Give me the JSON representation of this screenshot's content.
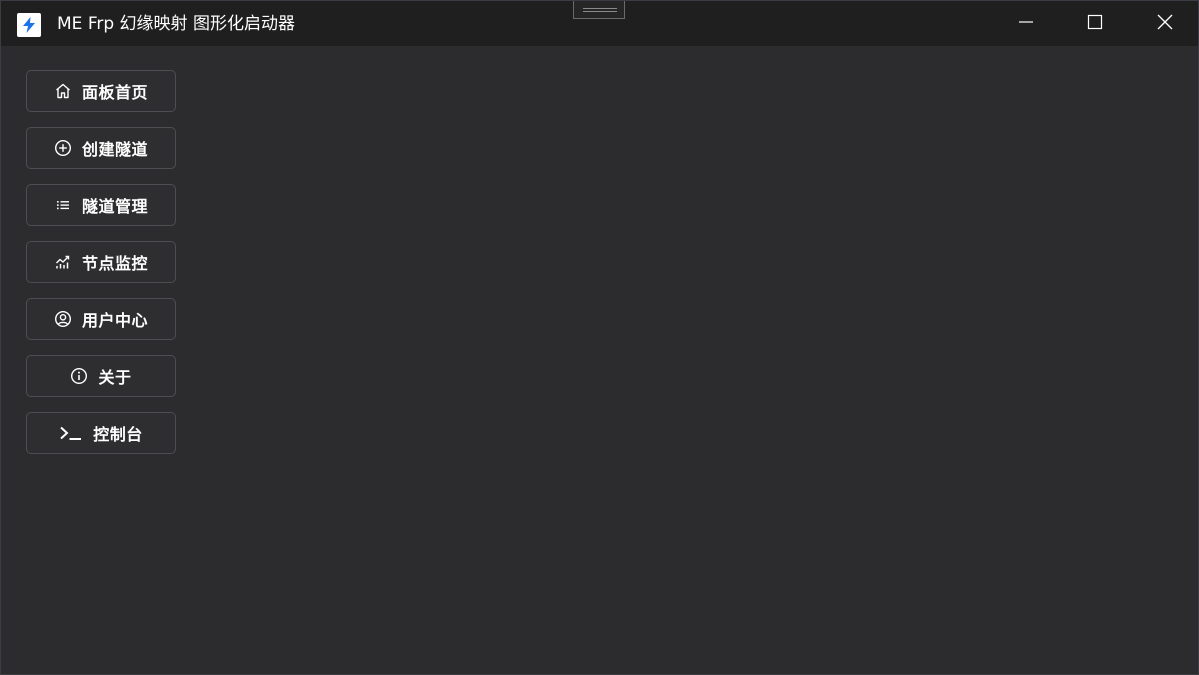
{
  "window": {
    "title": "ME Frp 幻缘映射 图形化启动器",
    "app_icon": "lightning-bolt-icon",
    "controls": [
      "minimize-icon",
      "maximize-icon",
      "close-icon"
    ]
  },
  "sidebar": {
    "items": [
      {
        "label": "面板首页",
        "icon": "home-icon"
      },
      {
        "label": "创建隧道",
        "icon": "plus-circle-icon"
      },
      {
        "label": "隧道管理",
        "icon": "list-icon"
      },
      {
        "label": "节点监控",
        "icon": "trend-chart-icon"
      },
      {
        "label": "用户中心",
        "icon": "user-circle-icon"
      },
      {
        "label": "关于",
        "icon": "info-circle-icon"
      },
      {
        "label": "控制台",
        "icon": "terminal-icon"
      }
    ]
  },
  "colors": {
    "titlebar": "#1f1f1f",
    "background": "#2c2c2f",
    "button_border": "#4e4e52",
    "accent": "#1a73e8",
    "text": "#ffffff"
  }
}
